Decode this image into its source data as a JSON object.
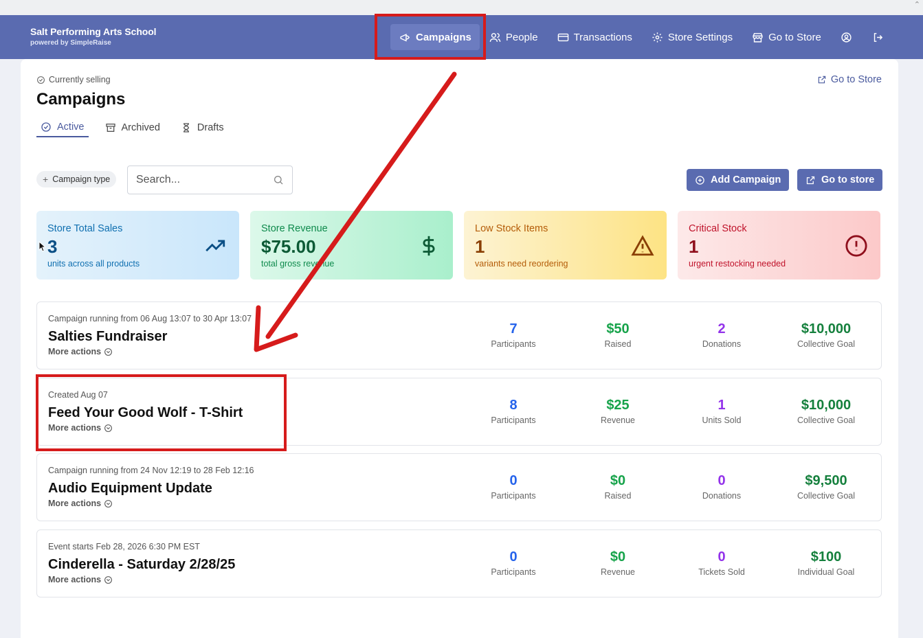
{
  "app": {
    "school_name": "Salt Performing Arts School",
    "powered_by": "powered by SimpleRaise"
  },
  "nav": {
    "items": [
      {
        "label": "Campaigns",
        "icon": "megaphone-icon",
        "active": true
      },
      {
        "label": "People",
        "icon": "users-icon"
      },
      {
        "label": "Transactions",
        "icon": "credit-card-icon"
      },
      {
        "label": "Store Settings",
        "icon": "gear-icon"
      },
      {
        "label": "Go to Store",
        "icon": "store-icon"
      }
    ],
    "icon_buttons": [
      "user-circle-icon",
      "logout-icon"
    ]
  },
  "header": {
    "currently_selling": "Currently selling",
    "title": "Campaigns",
    "go_to_store_link": "Go to Store"
  },
  "tabs": [
    {
      "label": "Active",
      "icon": "check-circle-icon",
      "active": true
    },
    {
      "label": "Archived",
      "icon": "archive-icon"
    },
    {
      "label": "Drafts",
      "icon": "hourglass-icon"
    }
  ],
  "filters": {
    "campaign_type_chip": "Campaign type",
    "search_placeholder": "Search..."
  },
  "actions": {
    "add_campaign": "Add Campaign",
    "go_to_store": "Go to store"
  },
  "stats": [
    {
      "label": "Store Total Sales",
      "value": "3",
      "desc": "units across all products",
      "icon": "trending-up-icon",
      "theme": "blue"
    },
    {
      "label": "Store Revenue",
      "value": "$75.00",
      "desc": "total gross revenue",
      "icon": "dollar-icon",
      "theme": "green"
    },
    {
      "label": "Low Stock Items",
      "value": "1",
      "desc": "variants need reordering",
      "icon": "warning-triangle-icon",
      "theme": "yellow"
    },
    {
      "label": "Critical Stock",
      "value": "1",
      "desc": "urgent restocking needed",
      "icon": "alert-circle-icon",
      "theme": "red"
    }
  ],
  "campaigns": [
    {
      "meta": "Campaign running from 06 Aug 13:07 to 30 Apr 13:07",
      "title": "Salties Fundraiser",
      "more": "More actions",
      "metrics": [
        {
          "num": "7",
          "label": "Participants"
        },
        {
          "num": "$50",
          "label": "Raised"
        },
        {
          "num": "2",
          "label": "Donations"
        },
        {
          "num": "$10,000",
          "label": "Collective Goal"
        }
      ]
    },
    {
      "meta": "Created Aug 07",
      "title": "Feed Your Good Wolf - T-Shirt",
      "more": "More actions",
      "metrics": [
        {
          "num": "8",
          "label": "Participants"
        },
        {
          "num": "$25",
          "label": "Revenue"
        },
        {
          "num": "1",
          "label": "Units Sold"
        },
        {
          "num": "$10,000",
          "label": "Collective Goal"
        }
      ]
    },
    {
      "meta": "Campaign running from 24 Nov 12:19 to 28 Feb 12:16",
      "title": "Audio Equipment Update",
      "more": "More actions",
      "metrics": [
        {
          "num": "0",
          "label": "Participants"
        },
        {
          "num": "$0",
          "label": "Raised"
        },
        {
          "num": "0",
          "label": "Donations"
        },
        {
          "num": "$9,500",
          "label": "Collective Goal"
        }
      ]
    },
    {
      "meta": "Event starts Feb 28, 2026 6:30 PM EST",
      "title": "Cinderella - Saturday 2/28/25",
      "more": "More actions",
      "metrics": [
        {
          "num": "0",
          "label": "Participants"
        },
        {
          "num": "$0",
          "label": "Revenue"
        },
        {
          "num": "0",
          "label": "Tickets Sold"
        },
        {
          "num": "$100",
          "label": "Individual Goal"
        }
      ]
    }
  ],
  "colors": {
    "navbar": "#5a6bb0",
    "annotation_red": "#d61b1b",
    "metric_blue": "#2563eb",
    "metric_green": "#16a34a",
    "metric_purple": "#9333ea"
  }
}
